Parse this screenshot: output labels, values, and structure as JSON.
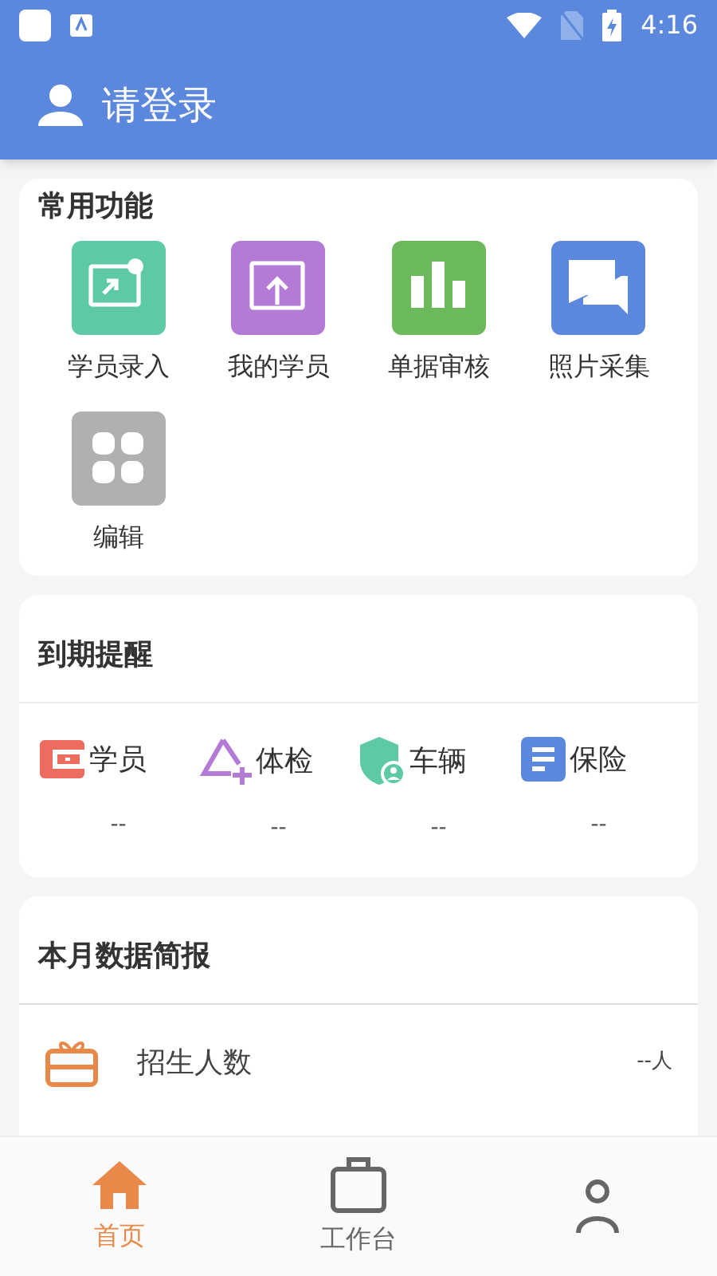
{
  "status_bar": {
    "time": "4:16"
  },
  "header": {
    "title": "请登录"
  },
  "common_functions": {
    "title": "常用功能",
    "items": [
      {
        "label": "学员录入",
        "kind": "enroll",
        "color": "#5ec9a6"
      },
      {
        "label": "我的学员",
        "kind": "upload",
        "color": "#b47bd6"
      },
      {
        "label": "单据审核",
        "kind": "chart",
        "color": "#6cb85c"
      },
      {
        "label": "照片采集",
        "kind": "chat",
        "color": "#5b88dc"
      },
      {
        "label": "编辑",
        "kind": "grid",
        "color": "#b0b0b0"
      }
    ]
  },
  "expiry_reminders": {
    "title": "到期提醒",
    "items": [
      {
        "label": "学员",
        "value": "--",
        "kind": "card",
        "color": "#ee6b60"
      },
      {
        "label": "体检",
        "value": "--",
        "kind": "health",
        "color": "#b47bd6"
      },
      {
        "label": "车辆",
        "value": "--",
        "kind": "shield",
        "color": "#5ec9a6"
      },
      {
        "label": "保险",
        "value": "--",
        "kind": "doc",
        "color": "#5b88dc"
      }
    ]
  },
  "monthly_report": {
    "title": "本月数据简报",
    "rows": [
      {
        "label": "招生人数",
        "value": "--人"
      }
    ]
  },
  "bottom_nav": [
    {
      "label": "首页",
      "kind": "home",
      "selected": true
    },
    {
      "label": "工作台",
      "kind": "bag",
      "selected": false
    },
    {
      "kind": "person",
      "selected": false
    }
  ]
}
